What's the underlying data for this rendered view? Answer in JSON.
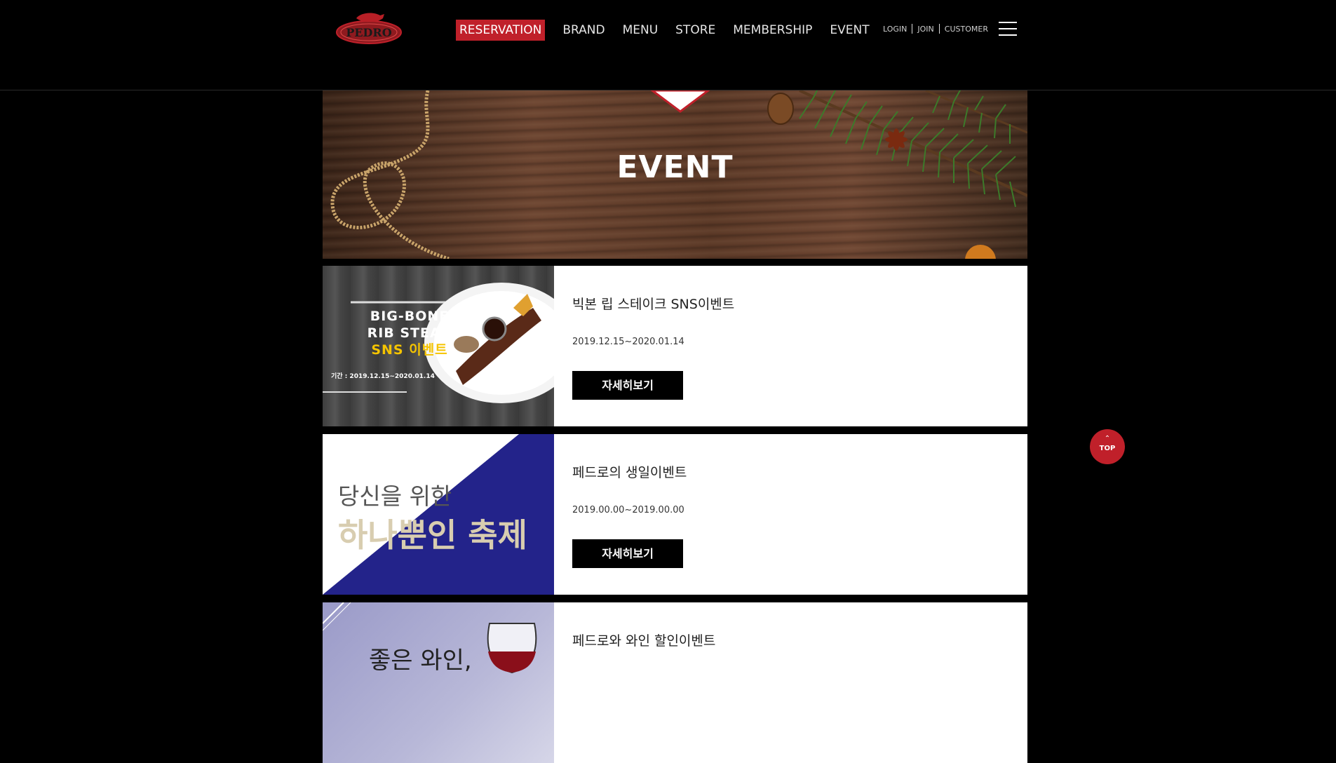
{
  "header": {
    "logo_text": "PEDRO",
    "nav": [
      "RESERVATION",
      "BRAND",
      "MENU",
      "STORE",
      "MEMBERSHIP",
      "EVENT"
    ],
    "active_nav": "RESERVATION",
    "util_links": [
      "LOGIN",
      "JOIN",
      "CUSTOMER"
    ]
  },
  "banner": {
    "title": "EVENT"
  },
  "events": [
    {
      "title": "빅본 립 스테이크 SNS이벤트",
      "date": "2019.12.15~2020.01.14",
      "button": "자세히보기",
      "thumb": {
        "line1": "BIG-BONE",
        "line2": "RIB STEAK",
        "line3": "SNS 이벤트",
        "period": "기간 : 2019.12.15~2020.01.14"
      }
    },
    {
      "title": "페드로의 생일이벤트",
      "date": "2019.00.00~2019.00.00",
      "button": "자세히보기",
      "thumb": {
        "line1": "당신을 위한",
        "line2": "하나뿐인 축제"
      }
    },
    {
      "title": "페드로와 와인 할인이벤트",
      "thumb": {
        "line1": "좋은 와인,"
      }
    }
  ],
  "top_button": {
    "label": "TOP"
  },
  "colors": {
    "accent": "#c0202a",
    "background": "#000000",
    "card": "#ffffff",
    "birthday_navy": "#23238a"
  }
}
